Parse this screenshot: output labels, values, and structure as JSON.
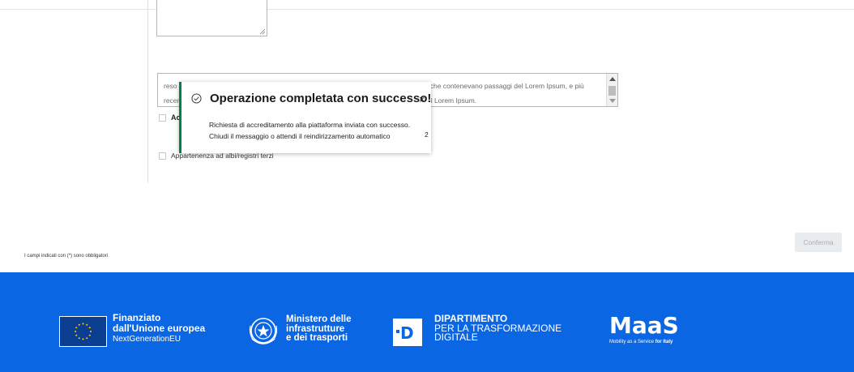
{
  "form": {
    "lorem_text": "reso popolare, negli anni '60, con la diffusione dei fogli di caratteri trasferibili \"Letraset\", che contenevano passaggi del Lorem Ipsum, e più recenti da software di impaginazione come Aldus PageMaker, che includeva versioni del Lorem Ipsum.",
    "checkbox_accept_label": "Ac",
    "checkbox_albi_label": "Appartenenza ad albi/registri terzi",
    "required_note": "I campi indicati con (*) sono obbligatori",
    "confirm_label": "Conferma"
  },
  "toast": {
    "title": "Operazione completata con successo!",
    "close_glyph": "×",
    "message_line1": "Richiesta di accreditamento alla piattaforma inviata con successo.",
    "message_line2": "Chiudi il messaggio o attendi il reindirizzamento automatico",
    "countdown": "2",
    "accent_color": "#00834a"
  },
  "footer": {
    "background_color": "#0b66e4",
    "eu_line1": "Finanziato",
    "eu_line2": "dall'Unione europea",
    "eu_line3": "NextGenerationEU",
    "mit_line1": "Ministero delle",
    "mit_line2": "infrastrutture",
    "mit_line3": "e dei trasporti",
    "dtd_letter": "D",
    "dtd_line1": "DIPARTIMENTO",
    "dtd_line2": "PER LA TRASFORMAZIONE",
    "dtd_line3": "DIGITALE",
    "maas_word": "MaaS",
    "maas_tag_prefix": "Mobility as a Service",
    "maas_tag_suffix": "for Italy"
  }
}
